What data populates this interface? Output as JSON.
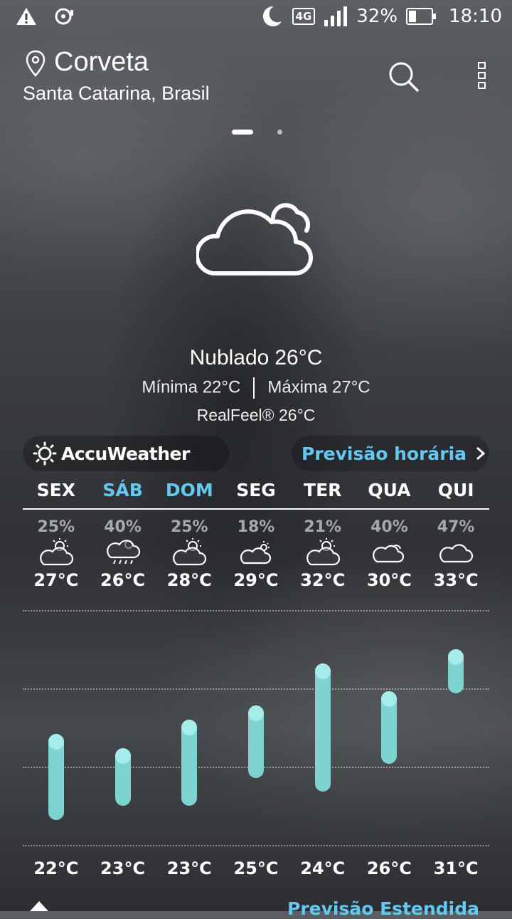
{
  "status_bar": {
    "network": "4G",
    "battery": "32%",
    "battery_level": 0.32,
    "time": "18:10",
    "icons": [
      "warning-icon",
      "disc-icon",
      "moon-icon",
      "signal-icon",
      "battery-icon"
    ]
  },
  "location": {
    "city": "Corveta",
    "region": "Santa Catarina, Brasil"
  },
  "current": {
    "condition": "Nublado",
    "temp": "26°C",
    "min": "Mínima 22°C",
    "max": "Máxima 27°C",
    "realfeel": "RealFeel® 26°C",
    "icon": "cloudy-icon"
  },
  "provider": "AccuWeather",
  "hourly_link": "Previsão horária",
  "extended_link": "Previsão Estendida",
  "colors": {
    "accent": "#64c8f0",
    "bar": "#7dd3d0",
    "weekend": "#64c8f0"
  },
  "chart_data": {
    "type": "bar",
    "categories": [
      "SEX",
      "SÁB",
      "DOM",
      "SEG",
      "TER",
      "QUA",
      "QUI"
    ],
    "series": [
      {
        "values": [
          27,
          26,
          28,
          29,
          32,
          30,
          33
        ]
      },
      {
        "values": [
          22,
          23,
          23,
          25,
          24,
          26,
          31
        ]
      }
    ],
    "ylim": [
      20,
      35
    ]
  },
  "forecast": [
    {
      "day": "SEX",
      "precip": "25%",
      "icon": "partly-sunny-icon",
      "high": "27°C",
      "low": "22°C",
      "hi_v": 27,
      "lo_v": 22,
      "weekend": false
    },
    {
      "day": "SÁB",
      "precip": "40%",
      "icon": "rain-cloud-icon",
      "high": "26°C",
      "low": "23°C",
      "hi_v": 26,
      "lo_v": 23,
      "weekend": true
    },
    {
      "day": "DOM",
      "precip": "25%",
      "icon": "partly-sunny-icon",
      "high": "28°C",
      "low": "23°C",
      "hi_v": 28,
      "lo_v": 23,
      "weekend": true
    },
    {
      "day": "SEG",
      "precip": "18%",
      "icon": "cloud-sun-icon",
      "high": "29°C",
      "low": "25°C",
      "hi_v": 29,
      "lo_v": 25,
      "weekend": false
    },
    {
      "day": "TER",
      "precip": "21%",
      "icon": "partly-sunny-icon",
      "high": "32°C",
      "low": "24°C",
      "hi_v": 32,
      "lo_v": 24,
      "weekend": false
    },
    {
      "day": "QUA",
      "precip": "40%",
      "icon": "cloudy-icon",
      "high": "30°C",
      "low": "26°C",
      "hi_v": 30,
      "lo_v": 26,
      "weekend": false
    },
    {
      "day": "QUI",
      "precip": "47%",
      "icon": "cloud-icon",
      "high": "33°C",
      "low": "31°C",
      "hi_v": 33,
      "lo_v": 31,
      "weekend": false
    }
  ]
}
